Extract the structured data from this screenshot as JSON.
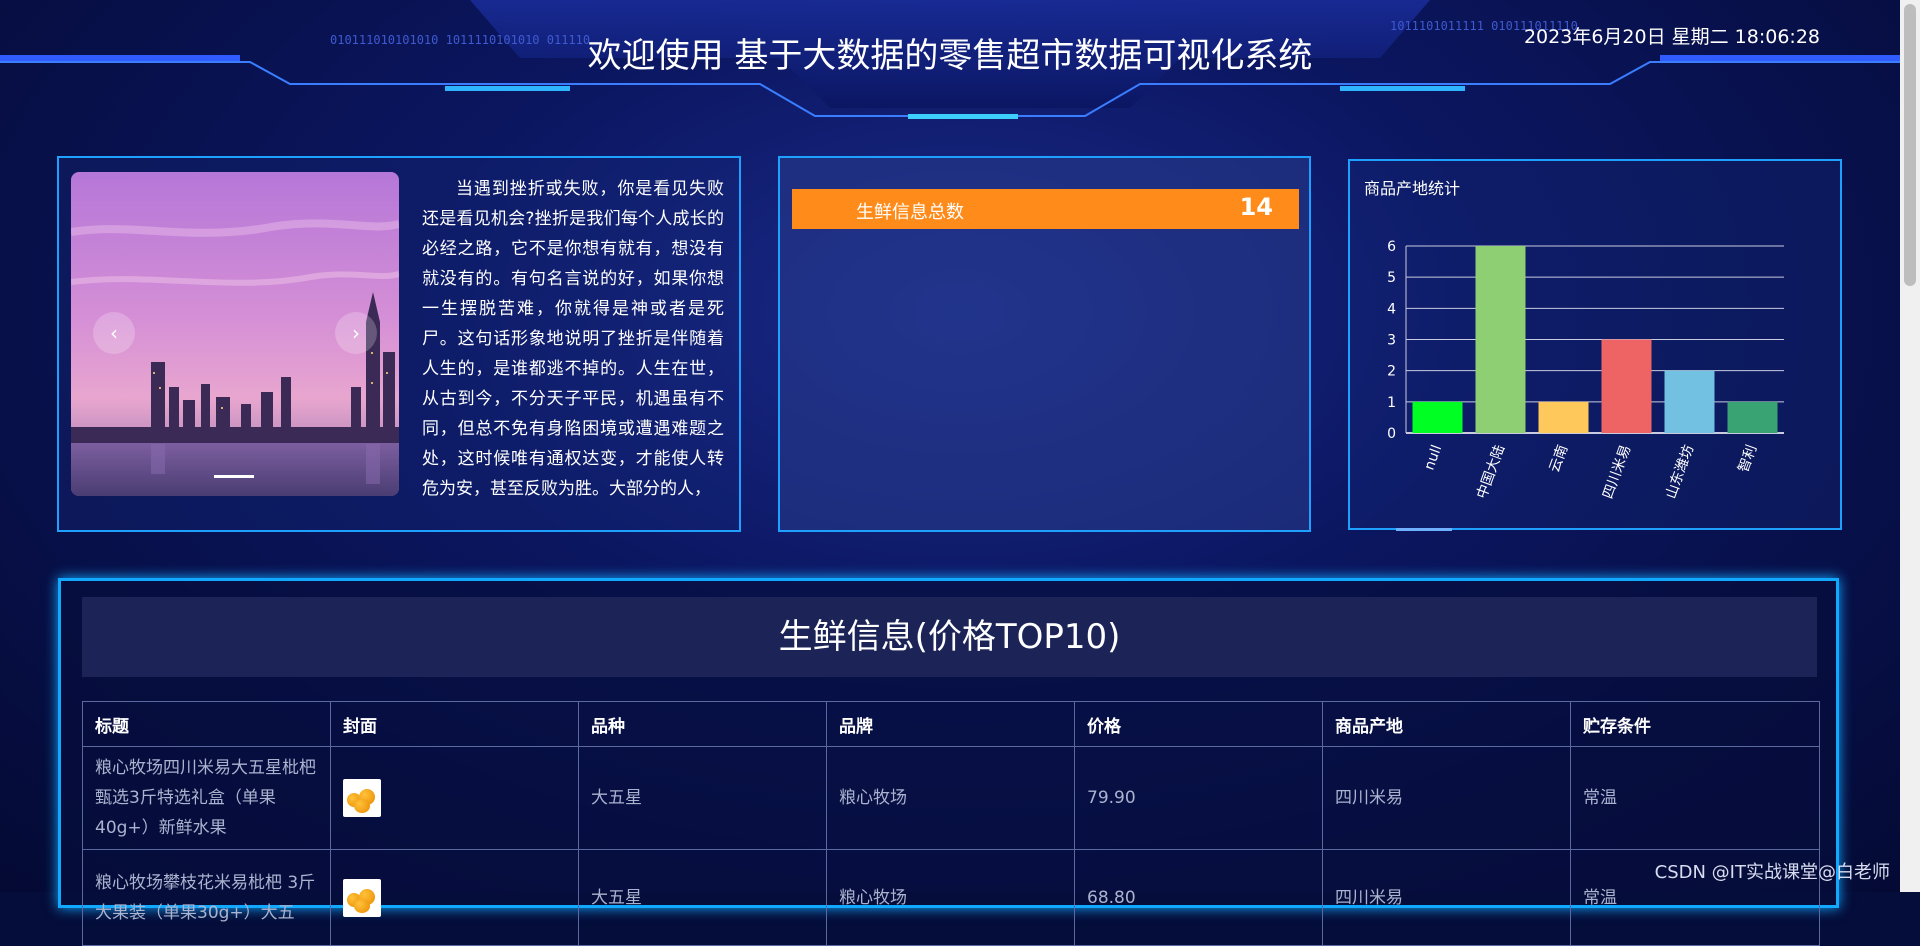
{
  "header": {
    "title": "欢迎使用 基于大数据的零售超市数据可视化系统",
    "datetime": "2023年6月20日 星期二 18:06:28",
    "binary_left": "010111010101010 1011110101010 011110",
    "binary_right": "1011101011111 010111011110"
  },
  "carousel": {
    "prev_icon": "‹",
    "next_icon": "›",
    "image": "city-skyline-sunset"
  },
  "intro_text": "当遇到挫折或失败，你是看见失败还是看见机会?挫折是我们每个人成长的必经之路，它不是你想有就有，想没有就没有的。有句名言说的好，如果你想一生摆脱苦难，你就得是神或者是死尸。这句话形象地说明了挫折是伴随着人生的，是谁都逃不掉的。人生在世，从古到今，不分天子平民，机遇虽有不同，但总不免有身陷困境或遭遇难题之处，这时候唯有通权达变，才能使人转危为安，甚至反败为胜。大部分的人，",
  "stat": {
    "label": "生鲜信息总数",
    "value": "14"
  },
  "chart_panel": {
    "title": "商品产地统计"
  },
  "chart_data": {
    "type": "bar",
    "title": "商品产地统计",
    "categories": [
      "null",
      "中国大陆",
      "云南",
      "四川米易",
      "山东潍坊",
      "智利"
    ],
    "values": [
      1,
      6,
      1,
      3,
      2,
      1
    ],
    "colors": [
      "#00ff22",
      "#8dcf72",
      "#ffc85a",
      "#ee6464",
      "#72c1e2",
      "#3aa374"
    ],
    "ylim": [
      0,
      6
    ],
    "yticks": [
      0,
      1,
      2,
      3,
      4,
      5,
      6
    ],
    "grid": true
  },
  "table_section": {
    "title": "生鲜信息(价格TOP10)",
    "columns": [
      "标题",
      "封面",
      "品种",
      "品牌",
      "价格",
      "商品产地",
      "贮存条件"
    ],
    "rows": [
      {
        "title": "粮心牧场四川米易大五星枇杷 甄选3斤特选礼盒（单果40g+）新鲜水果",
        "cover": "loquat-thumbnail",
        "variety": "大五星",
        "brand": "粮心牧场",
        "price": "79.90",
        "origin": "四川米易",
        "storage": "常温"
      },
      {
        "title": "粮心牧场攀枝花米易枇杷 3斤大果装（单果30g+）大五",
        "cover": "loquat-thumbnail",
        "variety": "大五星",
        "brand": "粮心牧场",
        "price": "68.80",
        "origin": "四川米易",
        "storage": "常温"
      }
    ]
  },
  "watermark": "CSDN @IT实战课堂@白老师"
}
